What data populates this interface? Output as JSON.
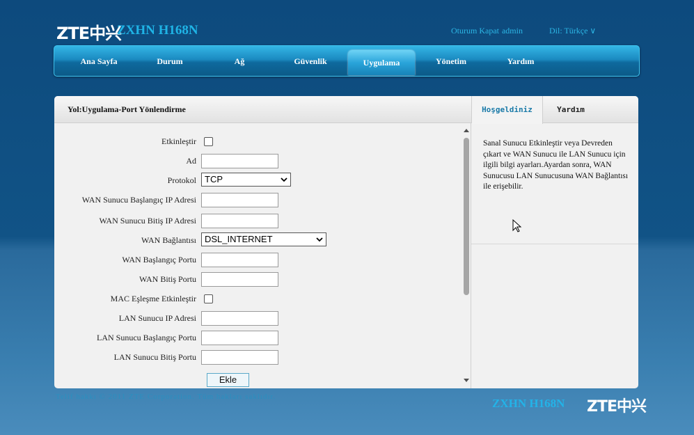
{
  "brand": {
    "logo": "ZTE中兴",
    "model": "ZXHN H168N"
  },
  "top": {
    "logout": "Oturum Kapat",
    "user": "admin",
    "language": "Dil: Türkçe ∨"
  },
  "nav": [
    {
      "label": "Ana Sayfa"
    },
    {
      "label": "Durum"
    },
    {
      "label": "Ağ"
    },
    {
      "label": "Güvenlik"
    },
    {
      "label": "Uygulama",
      "active": true
    },
    {
      "label": "Yönetim"
    },
    {
      "label": "Yardım"
    }
  ],
  "breadcrumb": "Yol:Uygulama-Port Yönlendirme",
  "right_tabs": {
    "welcome": "Hoşgeldiniz",
    "help": "Yardım"
  },
  "form": {
    "enable_label": "Etkinleştir",
    "name_label": "Ad",
    "protocol_label": "Protokol",
    "protocol_value": "TCP",
    "wan_start_ip_label": "WAN Sunucu Başlangıç IP Adresi",
    "wan_end_ip_label": "WAN Sunucu Bitiş IP Adresi",
    "wan_conn_label": "WAN Bağlantısı",
    "wan_conn_value": "DSL_INTERNET",
    "wan_start_port_label": "WAN Başlangıç Portu",
    "wan_end_port_label": "WAN Bitiş Portu",
    "mac_label": "MAC Eşleşme Etkinleştir",
    "lan_ip_label": "LAN Sunucu IP Adresi",
    "lan_start_port_label": "LAN Sunucu Başlangıç Portu",
    "lan_end_port_label": "LAN Sunucu Bitiş Portu",
    "add_button": "Ekle"
  },
  "help_text": "Sanal Sunucu Etkinleştir veya Devreden çıkart ve WAN Sunucu ile LAN Sunucu için ilgili bilgi ayarları.Ayardan sonra, WAN Sunucusu LAN Sunucusuna WAN Bağlantısı ile erişebilir.",
  "footer": {
    "copyright": "Telif hakkı © 2011 ZTE Corporation. Tüm hakları saklıdır."
  },
  "colors": {
    "accent": "#1fb4e6",
    "nav_active": "#2aa4da",
    "background": "#115386"
  }
}
